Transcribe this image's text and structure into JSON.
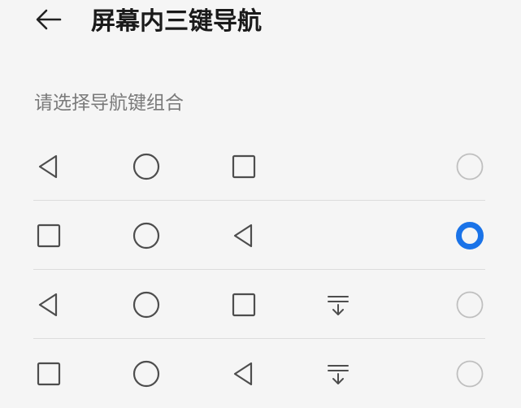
{
  "header": {
    "title": "屏幕内三键导航",
    "back_icon": "arrow-left-icon"
  },
  "section": {
    "label": "请选择导航键组合"
  },
  "colors": {
    "accent": "#1A73E8",
    "icon_stroke": "#4d4d4d",
    "radio_off": "#bfbfbf",
    "divider": "#dcdcdc"
  },
  "options": [
    {
      "keys": [
        "back-triangle-icon",
        "home-circle-icon",
        "recents-square-icon"
      ],
      "selected": false
    },
    {
      "keys": [
        "recents-square-icon",
        "home-circle-icon",
        "back-triangle-icon"
      ],
      "selected": true
    },
    {
      "keys": [
        "back-triangle-icon",
        "home-circle-icon",
        "recents-square-icon",
        "notification-pulldown-icon"
      ],
      "selected": false
    },
    {
      "keys": [
        "recents-square-icon",
        "home-circle-icon",
        "back-triangle-icon",
        "notification-pulldown-icon"
      ],
      "selected": false
    }
  ]
}
